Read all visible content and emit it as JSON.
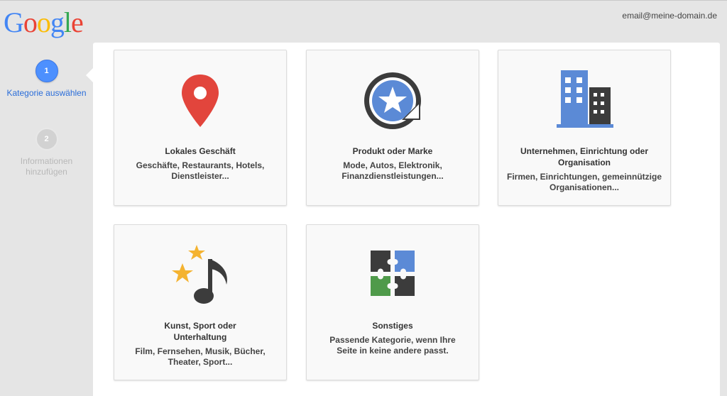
{
  "header": {
    "logo": "Google",
    "email": "email@meine-domain.de"
  },
  "colors": {
    "blue": "#4285f4",
    "red": "#ea4335",
    "yellow": "#fbbc05",
    "green": "#34a853",
    "dark": "#3c3c3c",
    "accent_blue": "#4d90fe"
  },
  "sidebar": {
    "steps": [
      {
        "number": "1",
        "label": "Kategorie auswählen"
      },
      {
        "number": "2",
        "label": "Informationen hinzufügen"
      }
    ]
  },
  "cards": [
    {
      "icon": "map-pin-icon",
      "title": "Lokales Geschäft",
      "desc": "Geschäfte, Restaurants, Hotels, Dienstleister..."
    },
    {
      "icon": "star-badge-icon",
      "title": "Produkt oder Marke",
      "desc": "Mode, Autos, Elektronik, Finanzdienstleistungen..."
    },
    {
      "icon": "buildings-icon",
      "title": "Unternehmen, Einrichtung oder Organisation",
      "desc": "Firmen, Einrichtungen, gemeinnützige Organisationen..."
    },
    {
      "icon": "stars-music-note-icon",
      "title": "Kunst, Sport oder Unterhaltung",
      "desc": "Film, Fernsehen, Musik, Bücher, Theater, Sport..."
    },
    {
      "icon": "puzzle-icon",
      "title": "Sonstiges",
      "desc": "Passende Kategorie, wenn Ihre Seite in keine andere passt."
    }
  ]
}
